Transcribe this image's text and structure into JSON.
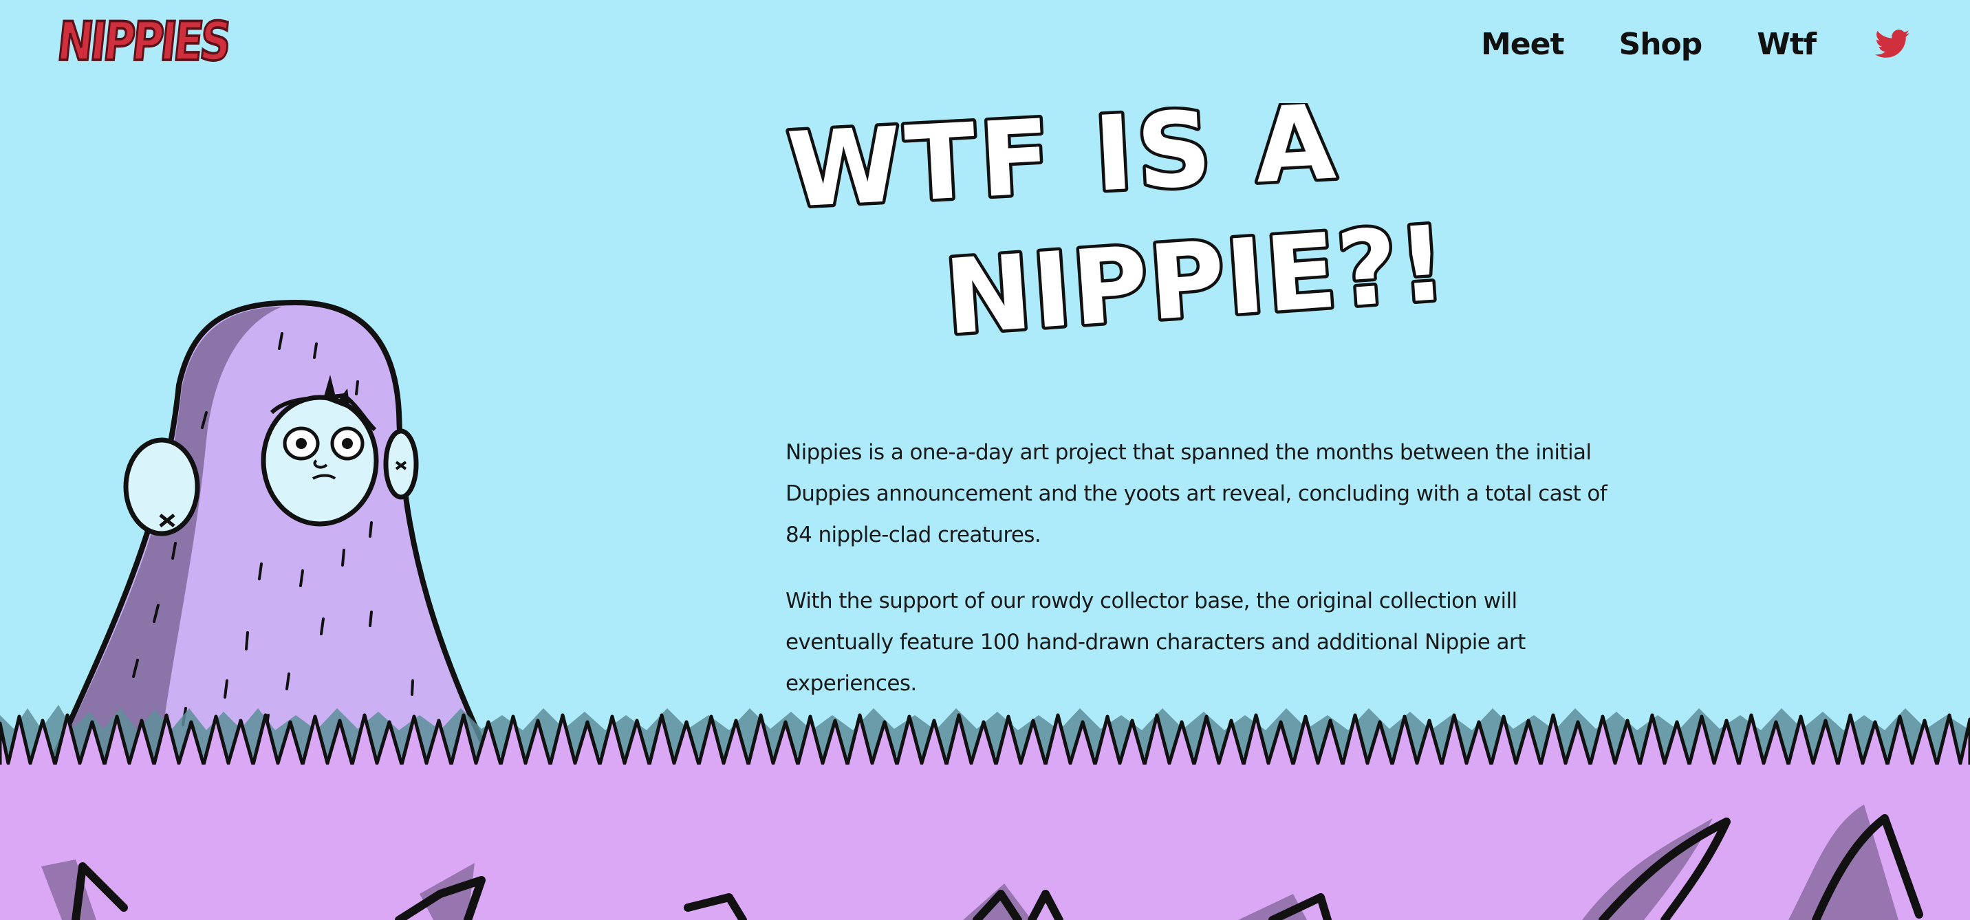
{
  "header": {
    "logo_text": "NIPPIES",
    "nav": [
      {
        "label": "Meet"
      },
      {
        "label": "Shop"
      },
      {
        "label": "Wtf"
      }
    ],
    "social_icon": "twitter-icon"
  },
  "hero": {
    "title_line1": "WTF IS A",
    "title_line2": "NIPPIE?!"
  },
  "content": {
    "paragraph1": "Nippies is a one-a-day art project that spanned the months between the initial Duppies announcement and the yoots art reveal, concluding with a total cast of 84 nipple-clad creatures.",
    "paragraph2": "With the support of our rowdy collector base, the original collection will eventually feature 100 hand-drawn characters and additional Nippie art experiences."
  },
  "colors": {
    "sky": "#aeebfa",
    "grass": "#dba8f6",
    "character_body": "#cbb0f3",
    "brand_red": "#d0303d"
  }
}
